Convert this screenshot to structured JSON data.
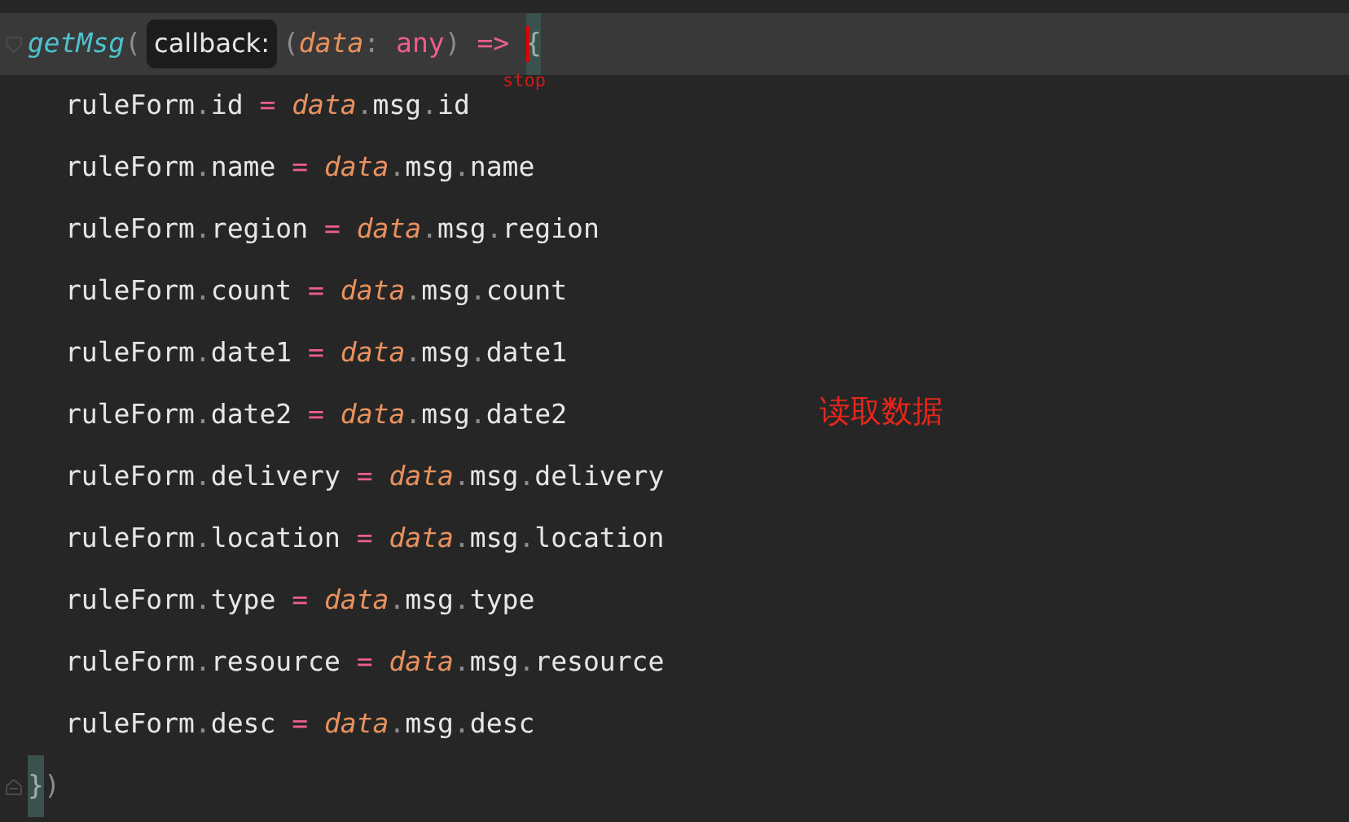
{
  "editor": {
    "lines": [
      {
        "current": true,
        "fold_start": true,
        "indent": false,
        "segments": [
          {
            "kind": "code",
            "tokens": [
              {
                "text": "getMsg",
                "kind": "function"
              },
              {
                "text": "(",
                "kind": "punct"
              }
            ]
          },
          {
            "kind": "hint",
            "text": "callback:"
          },
          {
            "kind": "code",
            "tokens": [
              {
                "text": "(",
                "kind": "punct"
              },
              {
                "text": "data",
                "kind": "param"
              },
              {
                "text": ": ",
                "kind": "punct"
              },
              {
                "text": "any",
                "kind": "keyword"
              },
              {
                "text": ")",
                "kind": "punct"
              },
              {
                "text": " => ",
                "kind": "keyword"
              },
              {
                "text": "{",
                "kind": "brace-match",
                "caret_label": "stop"
              }
            ]
          }
        ]
      },
      {
        "current": false,
        "indent": true,
        "segments": [
          {
            "kind": "code",
            "tokens": [
              {
                "text": "ruleForm",
                "kind": "ident"
              },
              {
                "text": ".",
                "kind": "dot"
              },
              {
                "text": "id",
                "kind": "ident"
              },
              {
                "text": " = ",
                "kind": "keyword"
              },
              {
                "text": "data",
                "kind": "param"
              },
              {
                "text": ".",
                "kind": "dot"
              },
              {
                "text": "msg",
                "kind": "ident"
              },
              {
                "text": ".",
                "kind": "dot"
              },
              {
                "text": "id",
                "kind": "ident"
              }
            ]
          }
        ]
      },
      {
        "current": false,
        "indent": true,
        "segments": [
          {
            "kind": "code",
            "tokens": [
              {
                "text": "ruleForm",
                "kind": "ident"
              },
              {
                "text": ".",
                "kind": "dot"
              },
              {
                "text": "name",
                "kind": "ident"
              },
              {
                "text": " = ",
                "kind": "keyword"
              },
              {
                "text": "data",
                "kind": "param"
              },
              {
                "text": ".",
                "kind": "dot"
              },
              {
                "text": "msg",
                "kind": "ident"
              },
              {
                "text": ".",
                "kind": "dot"
              },
              {
                "text": "name",
                "kind": "ident"
              }
            ]
          }
        ]
      },
      {
        "current": false,
        "indent": true,
        "segments": [
          {
            "kind": "code",
            "tokens": [
              {
                "text": "ruleForm",
                "kind": "ident"
              },
              {
                "text": ".",
                "kind": "dot"
              },
              {
                "text": "region",
                "kind": "ident"
              },
              {
                "text": " = ",
                "kind": "keyword"
              },
              {
                "text": "data",
                "kind": "param"
              },
              {
                "text": ".",
                "kind": "dot"
              },
              {
                "text": "msg",
                "kind": "ident"
              },
              {
                "text": ".",
                "kind": "dot"
              },
              {
                "text": "region",
                "kind": "ident"
              }
            ]
          }
        ]
      },
      {
        "current": false,
        "indent": true,
        "segments": [
          {
            "kind": "code",
            "tokens": [
              {
                "text": "ruleForm",
                "kind": "ident"
              },
              {
                "text": ".",
                "kind": "dot"
              },
              {
                "text": "count",
                "kind": "ident"
              },
              {
                "text": " = ",
                "kind": "keyword"
              },
              {
                "text": "data",
                "kind": "param"
              },
              {
                "text": ".",
                "kind": "dot"
              },
              {
                "text": "msg",
                "kind": "ident"
              },
              {
                "text": ".",
                "kind": "dot"
              },
              {
                "text": "count",
                "kind": "ident"
              }
            ]
          }
        ]
      },
      {
        "current": false,
        "indent": true,
        "segments": [
          {
            "kind": "code",
            "tokens": [
              {
                "text": "ruleForm",
                "kind": "ident"
              },
              {
                "text": ".",
                "kind": "dot"
              },
              {
                "text": "date1",
                "kind": "ident"
              },
              {
                "text": " = ",
                "kind": "keyword"
              },
              {
                "text": "data",
                "kind": "param"
              },
              {
                "text": ".",
                "kind": "dot"
              },
              {
                "text": "msg",
                "kind": "ident"
              },
              {
                "text": ".",
                "kind": "dot"
              },
              {
                "text": "date1",
                "kind": "ident"
              }
            ]
          }
        ]
      },
      {
        "current": false,
        "indent": true,
        "segments": [
          {
            "kind": "code",
            "tokens": [
              {
                "text": "ruleForm",
                "kind": "ident"
              },
              {
                "text": ".",
                "kind": "dot"
              },
              {
                "text": "date2",
                "kind": "ident"
              },
              {
                "text": " = ",
                "kind": "keyword"
              },
              {
                "text": "data",
                "kind": "param"
              },
              {
                "text": ".",
                "kind": "dot"
              },
              {
                "text": "msg",
                "kind": "ident"
              },
              {
                "text": ".",
                "kind": "dot"
              },
              {
                "text": "date2",
                "kind": "ident"
              }
            ]
          }
        ]
      },
      {
        "current": false,
        "indent": true,
        "segments": [
          {
            "kind": "code",
            "tokens": [
              {
                "text": "ruleForm",
                "kind": "ident"
              },
              {
                "text": ".",
                "kind": "dot"
              },
              {
                "text": "delivery",
                "kind": "ident"
              },
              {
                "text": " = ",
                "kind": "keyword"
              },
              {
                "text": "data",
                "kind": "param"
              },
              {
                "text": ".",
                "kind": "dot"
              },
              {
                "text": "msg",
                "kind": "ident"
              },
              {
                "text": ".",
                "kind": "dot"
              },
              {
                "text": "delivery",
                "kind": "ident"
              }
            ]
          }
        ]
      },
      {
        "current": false,
        "indent": true,
        "segments": [
          {
            "kind": "code",
            "tokens": [
              {
                "text": "ruleForm",
                "kind": "ident"
              },
              {
                "text": ".",
                "kind": "dot"
              },
              {
                "text": "location",
                "kind": "ident"
              },
              {
                "text": " = ",
                "kind": "keyword"
              },
              {
                "text": "data",
                "kind": "param"
              },
              {
                "text": ".",
                "kind": "dot"
              },
              {
                "text": "msg",
                "kind": "ident"
              },
              {
                "text": ".",
                "kind": "dot"
              },
              {
                "text": "location",
                "kind": "ident"
              }
            ]
          }
        ]
      },
      {
        "current": false,
        "indent": true,
        "segments": [
          {
            "kind": "code",
            "tokens": [
              {
                "text": "ruleForm",
                "kind": "ident"
              },
              {
                "text": ".",
                "kind": "dot"
              },
              {
                "text": "type",
                "kind": "ident"
              },
              {
                "text": " = ",
                "kind": "keyword"
              },
              {
                "text": "data",
                "kind": "param"
              },
              {
                "text": ".",
                "kind": "dot"
              },
              {
                "text": "msg",
                "kind": "ident"
              },
              {
                "text": ".",
                "kind": "dot"
              },
              {
                "text": "type",
                "kind": "ident"
              }
            ]
          }
        ]
      },
      {
        "current": false,
        "indent": true,
        "segments": [
          {
            "kind": "code",
            "tokens": [
              {
                "text": "ruleForm",
                "kind": "ident"
              },
              {
                "text": ".",
                "kind": "dot"
              },
              {
                "text": "resource",
                "kind": "ident"
              },
              {
                "text": " = ",
                "kind": "keyword"
              },
              {
                "text": "data",
                "kind": "param"
              },
              {
                "text": ".",
                "kind": "dot"
              },
              {
                "text": "msg",
                "kind": "ident"
              },
              {
                "text": ".",
                "kind": "dot"
              },
              {
                "text": "resource",
                "kind": "ident"
              }
            ]
          }
        ]
      },
      {
        "current": false,
        "indent": true,
        "segments": [
          {
            "kind": "code",
            "tokens": [
              {
                "text": "ruleForm",
                "kind": "ident"
              },
              {
                "text": ".",
                "kind": "dot"
              },
              {
                "text": "desc",
                "kind": "ident"
              },
              {
                "text": " = ",
                "kind": "keyword"
              },
              {
                "text": "data",
                "kind": "param"
              },
              {
                "text": ".",
                "kind": "dot"
              },
              {
                "text": "msg",
                "kind": "ident"
              },
              {
                "text": ".",
                "kind": "dot"
              },
              {
                "text": "desc",
                "kind": "ident"
              }
            ]
          }
        ]
      },
      {
        "current": false,
        "fold_end": true,
        "indent": false,
        "segments": [
          {
            "kind": "code",
            "tokens": [
              {
                "text": "}",
                "kind": "brace-match"
              },
              {
                "text": ")",
                "kind": "punct"
              }
            ]
          }
        ]
      }
    ]
  },
  "annotation": {
    "text": "读取数据"
  }
}
